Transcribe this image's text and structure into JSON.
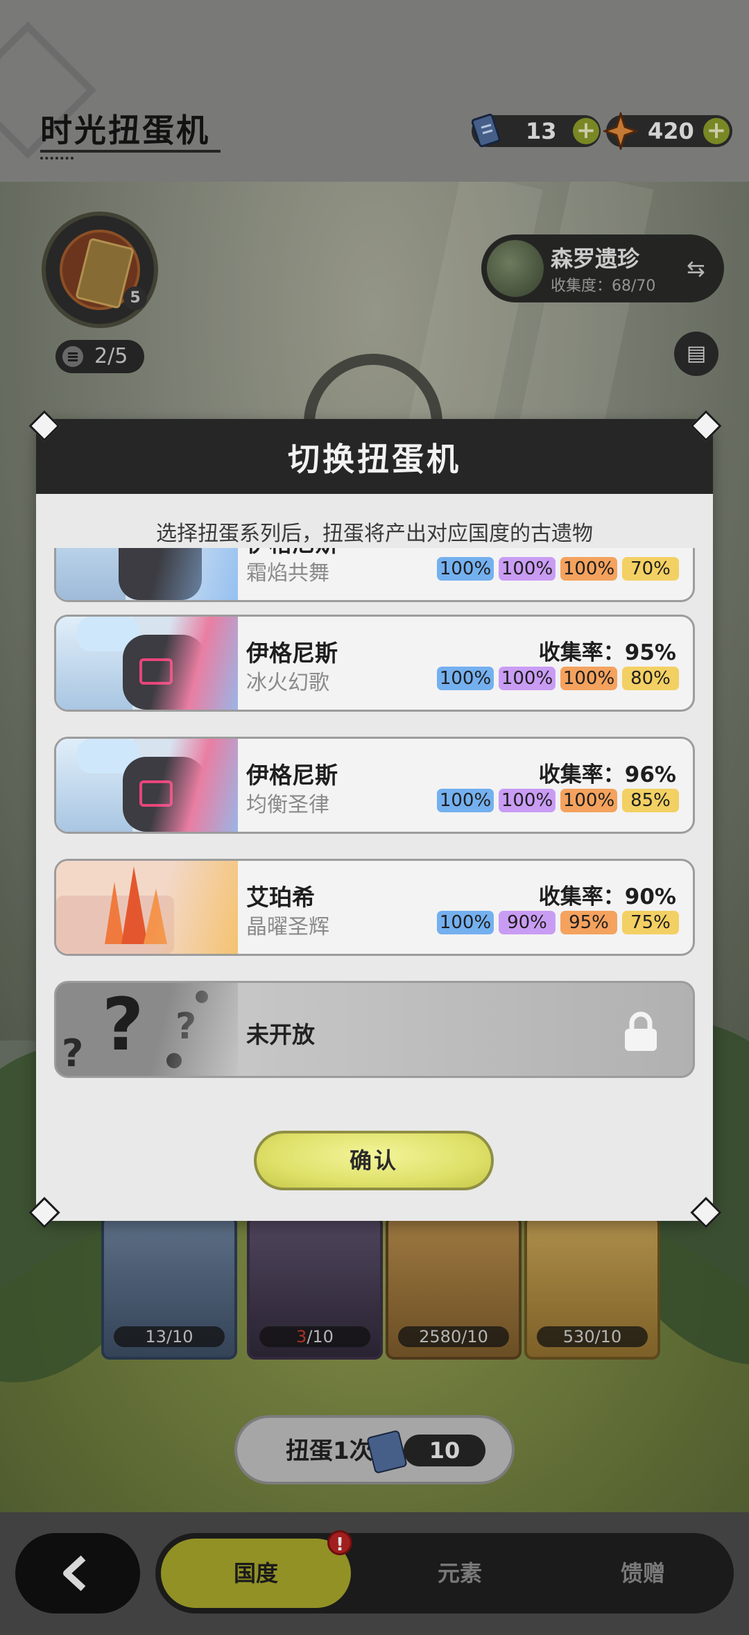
{
  "header": {
    "title": "时光扭蛋机",
    "tickets": "13",
    "gems": "420"
  },
  "machine": {
    "slot_badge": "5",
    "progress": "2/5"
  },
  "collection_card": {
    "name": "森罗遗珍",
    "rate": "收集度：68/70"
  },
  "modal": {
    "title": "切换扭蛋机",
    "subtitle": "选择扭蛋系列后，扭蛋将产出对应国度的古遗物",
    "rows": [
      {
        "name": "伊格尼斯",
        "sub": "霜焰共舞",
        "rate": "",
        "chips": [
          "100%",
          "100%",
          "100%",
          "70%"
        ],
        "theme": "ice-fire"
      },
      {
        "name": "伊格尼斯",
        "sub": "冰火幻歌",
        "rate": "收集率：95%",
        "chips": [
          "100%",
          "100%",
          "100%",
          "80%"
        ],
        "theme": "ice-fire"
      },
      {
        "name": "伊格尼斯",
        "sub": "均衡圣律",
        "rate": "收集率：96%",
        "chips": [
          "100%",
          "100%",
          "100%",
          "85%"
        ],
        "theme": "ice-fire"
      },
      {
        "name": "艾珀希",
        "sub": "晶曜圣辉",
        "rate": "收集率：90%",
        "chips": [
          "100%",
          "90%",
          "95%",
          "75%"
        ],
        "theme": "crystal"
      }
    ],
    "locked_label": "未开放",
    "confirm_label": "确认"
  },
  "cards": [
    {
      "count": "13/10"
    },
    {
      "count_red": "3",
      "count_rest": "/10"
    },
    {
      "count": "2580/10"
    },
    {
      "count": "530/10"
    }
  ],
  "draw": {
    "label": "扭蛋1次",
    "cost": "10"
  },
  "nav": {
    "tabs": [
      "国度",
      "元素",
      "馈赠"
    ],
    "badge": "!"
  },
  "colors": {
    "chip_blue": "#74b0ef",
    "chip_purple": "#c99cf4",
    "chip_orange": "#f4a25e",
    "chip_yellow": "#f3d063",
    "accent_olive": "#a6a52c"
  }
}
